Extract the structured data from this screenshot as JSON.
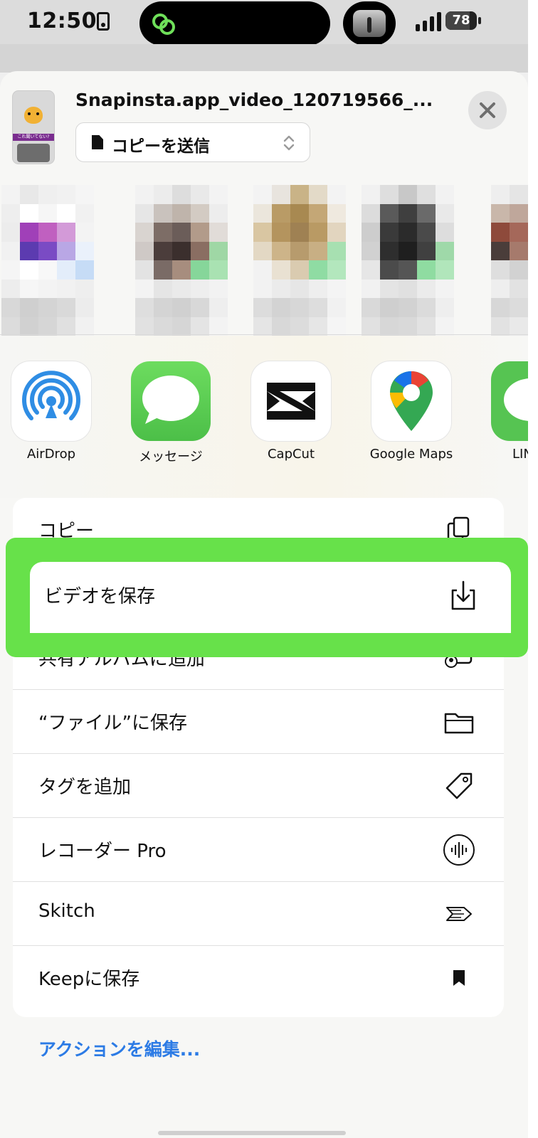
{
  "status": {
    "time": "12:50",
    "battery": "78",
    "battery_level": 0.78
  },
  "share_sheet": {
    "file_name": "Snapinsta.app_video_120719566_...",
    "thumbnail_caption": "これ聞いてない?",
    "send_mode": "コピーを送信",
    "close_icon": "close-icon"
  },
  "apps": [
    {
      "label": "AirDrop",
      "icon": "airdrop-icon"
    },
    {
      "label": "メッセージ",
      "icon": "messages-icon"
    },
    {
      "label": "CapCut",
      "icon": "capcut-icon"
    },
    {
      "label": "Google Maps",
      "icon": "google-maps-icon"
    },
    {
      "label": "LINE",
      "icon": "line-icon"
    }
  ],
  "actions": [
    {
      "label": "コピー",
      "icon": "copy-icon"
    },
    {
      "label": "ビデオを保存",
      "icon": "save-download-icon"
    },
    {
      "label": "共有アルバムに追加",
      "icon": "shared-album-icon"
    },
    {
      "label": "“ファイル”に保存",
      "icon": "folder-icon"
    },
    {
      "label": "タグを追加",
      "icon": "tag-icon"
    },
    {
      "label": "レコーダー Pro",
      "icon": "waveform-icon"
    },
    {
      "label": "Skitch",
      "icon": "skitch-arrow-icon"
    },
    {
      "label": "Keepに保存",
      "icon": "bookmark-icon"
    }
  ],
  "footer": {
    "edit_actions": "アクションを編集..."
  },
  "colors": {
    "highlight": "#67e14a",
    "link": "#2c7be5",
    "messages_green": "#5bc85a",
    "airdrop_blue": "#2f8de4",
    "line_green": "#56c452"
  }
}
